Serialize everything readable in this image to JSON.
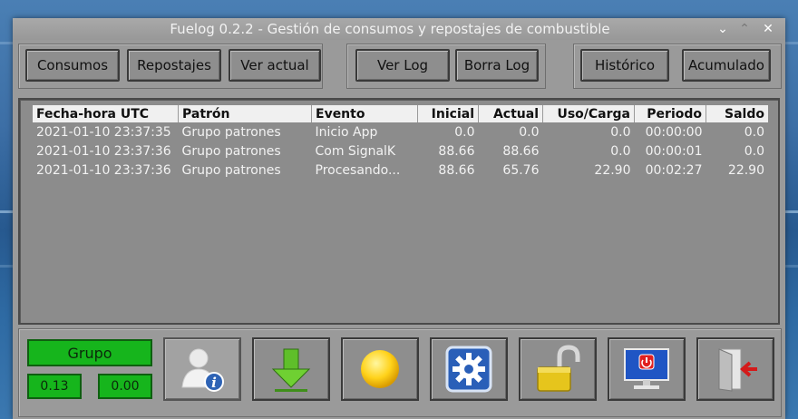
{
  "window": {
    "title": "Fuelog 0.2.2 - Gestión de consumos y repostajes de combustible"
  },
  "toolbar": {
    "consumos": "Consumos",
    "repostajes": "Repostajes",
    "ver_actual": "Ver actual",
    "ver_log": "Ver Log",
    "borra_log": "Borra Log",
    "historico": "Histórico",
    "acumulado": "Acumulado"
  },
  "log": {
    "columns": [
      "Fecha-hora UTC",
      "Patrón",
      "Evento",
      "Inicial",
      "Actual",
      "Uso/Carga",
      "Periodo",
      "Saldo"
    ],
    "rows": [
      [
        "2021-01-10 23:37:35",
        "Grupo patrones",
        "Inicio App",
        "0.0",
        "0.0",
        "0.0",
        "00:00:00",
        "0.0"
      ],
      [
        "2021-01-10 23:37:36",
        "Grupo patrones",
        "Com SignalK",
        "88.66",
        "88.66",
        "0.0",
        "00:00:01",
        "0.0"
      ],
      [
        "2021-01-10 23:37:36",
        "Grupo patrones",
        "Procesando...",
        "88.66",
        "65.76",
        "22.90",
        "00:02:27",
        "22.90"
      ]
    ]
  },
  "status": {
    "group_label": "Grupo",
    "value_left": "0.13",
    "value_right": "0.00"
  },
  "icons": [
    "user-info-icon",
    "download-arrow-icon",
    "sun-icon",
    "settings-gear-icon",
    "unlocked-padlock-icon",
    "power-monitor-icon",
    "exit-door-icon"
  ],
  "colors": {
    "window_bg": "#9a9a9a",
    "status_green": "#16b51c",
    "header_bg": "#f0f0f0"
  }
}
